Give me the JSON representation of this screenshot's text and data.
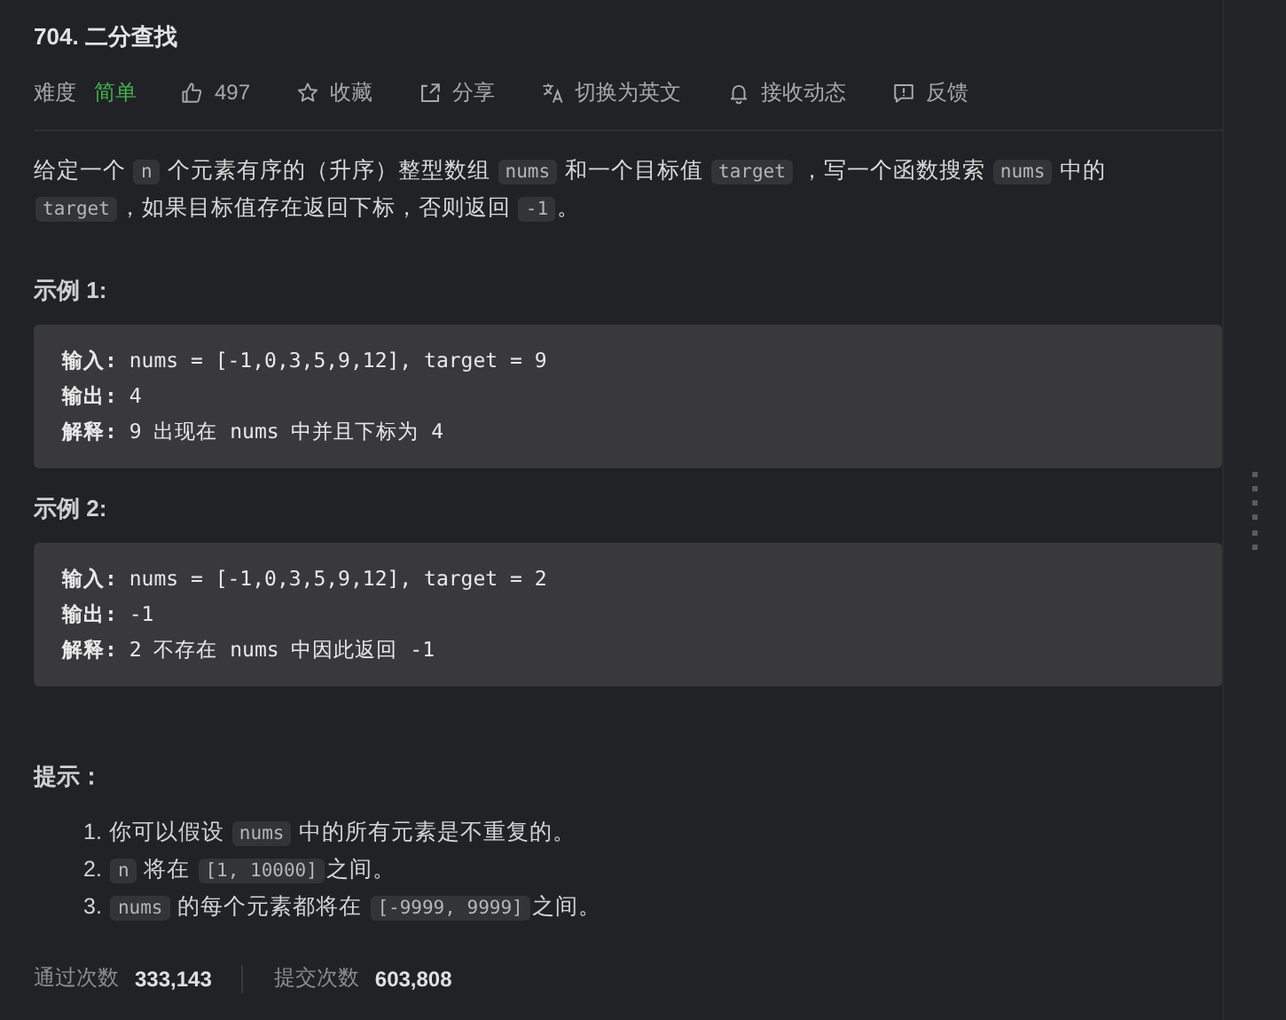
{
  "title": "704. 二分查找",
  "toolbar": {
    "difficulty_label": "难度",
    "difficulty": "简单",
    "actions": [
      {
        "kind": "like",
        "label": "497"
      },
      {
        "kind": "favorite",
        "label": "收藏"
      },
      {
        "kind": "share",
        "label": "分享"
      },
      {
        "kind": "translate",
        "label": "切换为英文"
      },
      {
        "kind": "notify",
        "label": "接收动态"
      },
      {
        "kind": "feedback",
        "label": "反馈"
      }
    ]
  },
  "description": [
    {
      "kind": "text",
      "text": "给定一个 "
    },
    {
      "kind": "code",
      "text": "n"
    },
    {
      "kind": "text",
      "text": " 个元素有序的（升序）整型数组 "
    },
    {
      "kind": "code",
      "text": "nums"
    },
    {
      "kind": "text",
      "text": " 和一个目标值 "
    },
    {
      "kind": "code",
      "text": "target"
    },
    {
      "kind": "text",
      "text": "  ，写一个函数搜索 "
    },
    {
      "kind": "code",
      "text": "nums"
    },
    {
      "kind": "text",
      "text": " 中的 "
    },
    {
      "kind": "code",
      "text": "target"
    },
    {
      "kind": "text",
      "text": "，如果目标值存在返回下标，否则返回 "
    },
    {
      "kind": "code",
      "text": "-1"
    },
    {
      "kind": "text",
      "text": "。"
    }
  ],
  "examples": [
    {
      "heading": "示例 1:",
      "lines": [
        "**输入:** nums = [-1,0,3,5,9,12], target = 9",
        "**输出:** 4",
        "**解释:** 9 出现在 nums 中并且下标为 4"
      ]
    },
    {
      "heading": "示例 2:",
      "lines": [
        "**输入:** nums = [-1,0,3,5,9,12], target = 2",
        "**输出:** -1",
        "**解释:** 2 不存在 nums 中因此返回 -1"
      ]
    }
  ],
  "hints": {
    "heading": "提示：",
    "items": [
      {
        "number": "1.",
        "segments": [
          {
            "kind": "text",
            "text": "你可以假设 "
          },
          {
            "kind": "code",
            "text": "nums"
          },
          {
            "kind": "text",
            "text": " 中的所有元素是不重复的。"
          }
        ]
      },
      {
        "number": "2.",
        "segments": [
          {
            "kind": "code",
            "text": "n"
          },
          {
            "kind": "text",
            "text": " 将在 "
          },
          {
            "kind": "code",
            "text": "[1, 10000]"
          },
          {
            "kind": "text",
            "text": "之间。"
          }
        ]
      },
      {
        "number": "3.",
        "segments": [
          {
            "kind": "code",
            "text": "nums"
          },
          {
            "kind": "text",
            "text": " 的每个元素都将在 "
          },
          {
            "kind": "code",
            "text": "[-9999, 9999]"
          },
          {
            "kind": "text",
            "text": "之间。"
          }
        ]
      }
    ]
  },
  "stats": [
    {
      "label": "通过次数",
      "value": "333,143"
    },
    {
      "label": "提交次数",
      "value": "603,808"
    }
  ]
}
